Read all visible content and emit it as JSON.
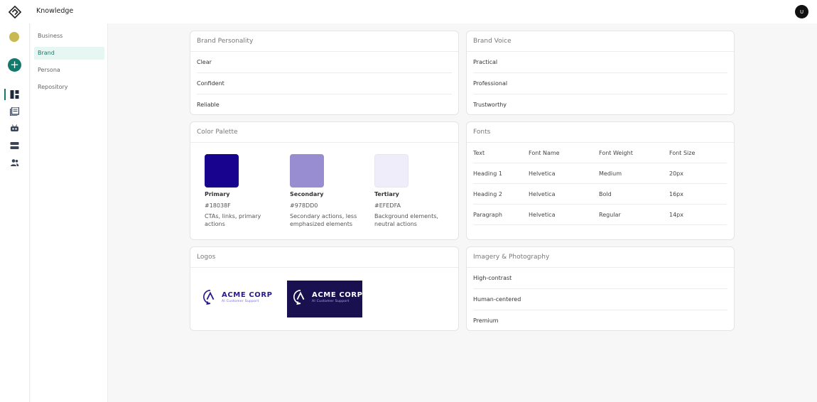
{
  "header": {
    "title": "Knowledge",
    "avatar_initial": "U"
  },
  "rail": {
    "plus_label": "+",
    "icons": [
      "dashboard-icon",
      "library-icon",
      "robot-icon",
      "storage-icon",
      "people-icon"
    ]
  },
  "sidebar": {
    "items": [
      {
        "label": "Business"
      },
      {
        "label": "Brand",
        "active": true
      },
      {
        "label": "Persona"
      },
      {
        "label": "Repository"
      }
    ]
  },
  "brand_personality": {
    "title": "Brand Personality",
    "items": [
      "Clear",
      "Confident",
      "Reliable"
    ]
  },
  "brand_voice": {
    "title": "Brand Voice",
    "items": [
      "Practical",
      "Professional",
      "Trustworthy"
    ]
  },
  "color_palette": {
    "title": "Color Palette",
    "colors": [
      {
        "name": "Primary",
        "hex": "#18038F",
        "desc": "CTAs, links, primary actions"
      },
      {
        "name": "Secondary",
        "hex": "#978DD0",
        "desc": "Secondary actions, less emphasized elements"
      },
      {
        "name": "Tertiary",
        "hex": "#EFEDFA",
        "desc": "Background elements, neutral actions"
      }
    ]
  },
  "fonts": {
    "title": "Fonts",
    "headers": [
      "Text",
      "Font Name",
      "Font Weight",
      "Font Size"
    ],
    "rows": [
      [
        "Heading 1",
        "Helvetica",
        "Medium",
        "20px"
      ],
      [
        "Heading 2",
        "Helvetica",
        "Bold",
        "16px"
      ],
      [
        "Paragraph",
        "Helvetica",
        "Regular",
        "14px"
      ]
    ]
  },
  "logos": {
    "title": "Logos",
    "items": [
      {
        "name": "ACME CORP",
        "tagline": "AI Customer Support",
        "variant": "light"
      },
      {
        "name": "ACME CORP",
        "tagline": "AI Customer Support",
        "variant": "dark"
      }
    ]
  },
  "imagery": {
    "title": "Imagery & Photography",
    "items": [
      "High-contrast",
      "Human-centered",
      "Premium"
    ]
  },
  "colors": {
    "accent": "#137a6b",
    "accent_light": "#e6f6f3",
    "status_dot": "#c9b954",
    "logo_dark_bg": "#18104f",
    "logo_primary": "#2a1b8f",
    "logo_accent": "#6a5fd6"
  }
}
